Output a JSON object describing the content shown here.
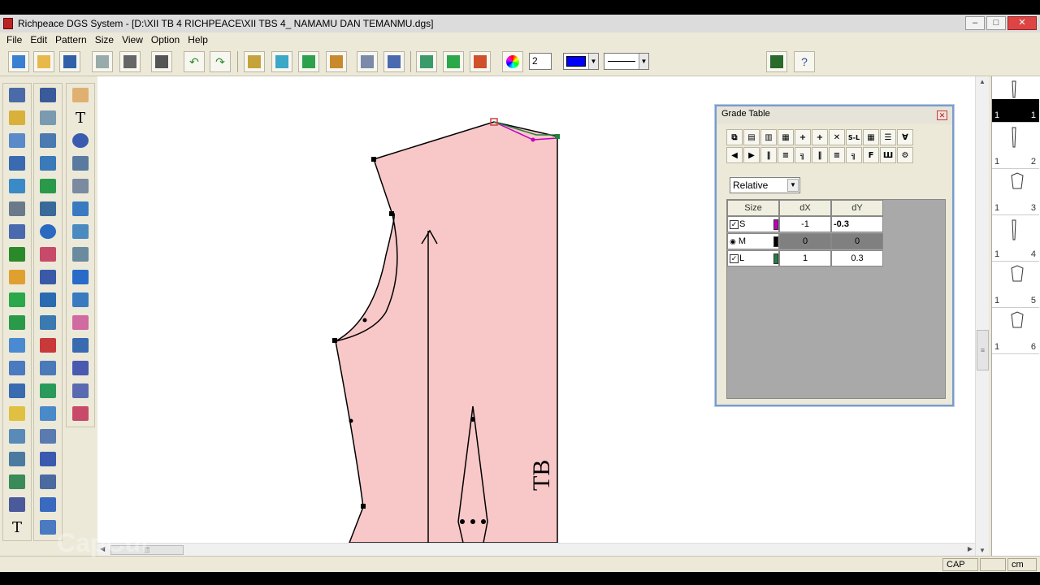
{
  "window": {
    "title": "Richpeace DGS System - [D:\\XII TB 4 RICHPEACE\\XII TBS 4_ NAMAMU DAN TEMANMU.dgs]"
  },
  "menu": [
    "File",
    "Edit",
    "Pattern",
    "Size",
    "View",
    "Option",
    "Help"
  ],
  "toolbar": {
    "step_value": "2",
    "color": "#0000ff"
  },
  "canvas": {
    "piece_label": "TB",
    "fill_color": "#f8c8c8"
  },
  "grade_table": {
    "title": "Grade Table",
    "mode": "Relative",
    "headers": [
      "Size",
      "dX",
      "dY"
    ],
    "rows": [
      {
        "size": "S",
        "color": "#c000c0",
        "dx": "-1",
        "dy": "-0.3",
        "checked": true
      },
      {
        "size": "M",
        "color": "#000000",
        "dx": "0",
        "dy": "0",
        "checked": false
      },
      {
        "size": "L",
        "color": "#208040",
        "dx": "1",
        "dy": "0.3",
        "checked": true
      }
    ]
  },
  "pieces": [
    {
      "qty": "1",
      "index": "1"
    },
    {
      "qty": "1",
      "index": "2"
    },
    {
      "qty": "1",
      "index": "3"
    },
    {
      "qty": "1",
      "index": "4"
    },
    {
      "qty": "1",
      "index": "5"
    },
    {
      "qty": "1",
      "index": "6"
    }
  ],
  "status": {
    "cap": "CAP",
    "unit": "cm"
  },
  "watermark": "CapCut"
}
